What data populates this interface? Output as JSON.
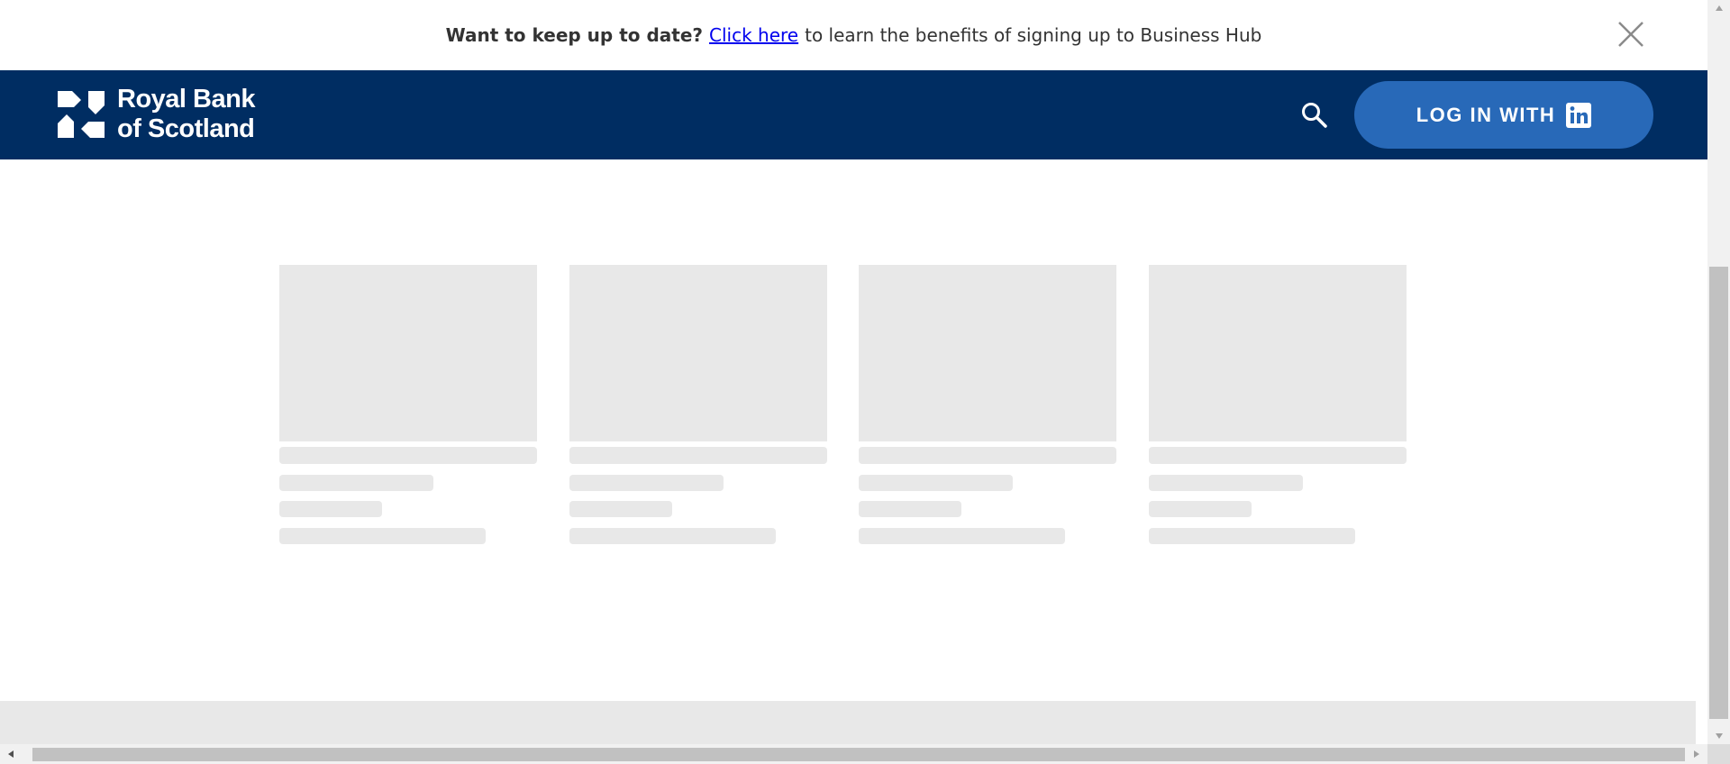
{
  "notice": {
    "lead": "Want to keep up to date?",
    "link_label": "Click here",
    "tail": "to learn the benefits of signing up to Business Hub",
    "close_icon": "close-icon"
  },
  "header": {
    "logo_line1": "Royal Bank",
    "logo_line2": "of Scotland",
    "search_icon": "search-icon",
    "login_label": "LOG IN WITH",
    "login_icon": "linkedin-icon"
  },
  "colors": {
    "header_bg": "#002d62",
    "login_button": "#2869b8",
    "skeleton": "#e8e8e8",
    "link": "#0000ee"
  },
  "cards": [
    {
      "state": "loading"
    },
    {
      "state": "loading"
    },
    {
      "state": "loading"
    },
    {
      "state": "loading"
    }
  ]
}
